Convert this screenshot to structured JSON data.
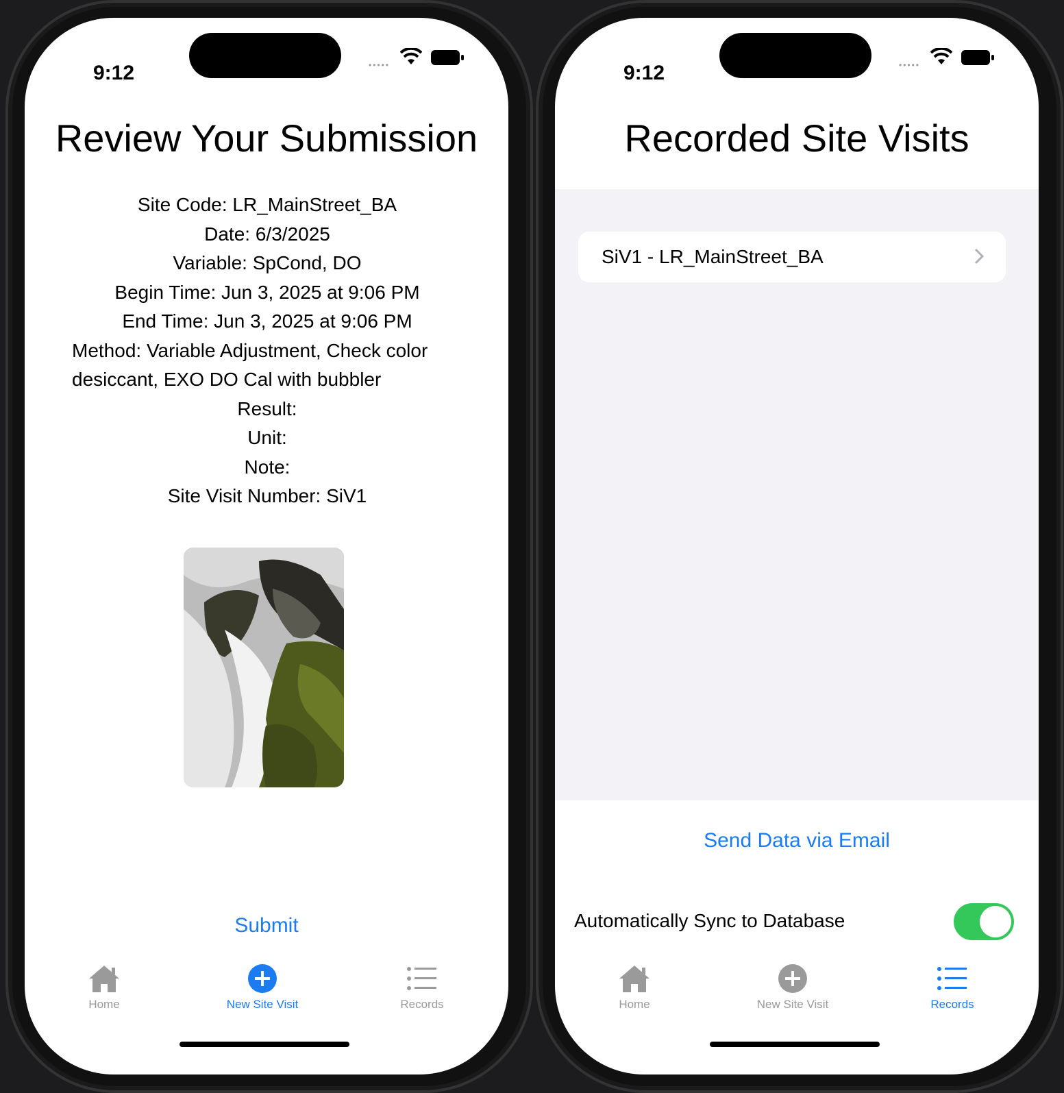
{
  "left": {
    "status_time": "9:12",
    "title": "Review Your Submission",
    "details": {
      "site_code": "Site Code: LR_MainStreet_BA",
      "date": "Date: 6/3/2025",
      "variable": "Variable: SpCond, DO",
      "begin_time": "Begin Time: Jun 3, 2025 at 9:06 PM",
      "end_time": "End Time: Jun 3, 2025 at 9:06 PM",
      "method": "Method: Variable Adjustment, Check color desiccant, EXO DO Cal with bubbler",
      "result": "Result:",
      "unit": "Unit:",
      "note": "Note:",
      "site_visit_number": "Site Visit Number: SiV1"
    },
    "submit_label": "Submit",
    "tabs": [
      {
        "label": "Home",
        "icon": "house-icon",
        "active": false
      },
      {
        "label": "New Site Visit",
        "icon": "plus-circle-icon",
        "active": true
      },
      {
        "label": "Records",
        "icon": "list-icon",
        "active": false
      }
    ]
  },
  "right": {
    "status_time": "9:12",
    "title": "Recorded Site Visits",
    "records": [
      {
        "label": "SiV1 - LR_MainStreet_BA"
      }
    ],
    "send_email_label": "Send Data via Email",
    "sync_label": "Automatically Sync to Database",
    "sync_enabled": true,
    "tabs": [
      {
        "label": "Home",
        "icon": "house-icon",
        "active": false
      },
      {
        "label": "New Site Visit",
        "icon": "plus-circle-icon",
        "active": false
      },
      {
        "label": "Records",
        "icon": "list-icon",
        "active": true
      }
    ]
  },
  "colors": {
    "accent": "#1a7cf0",
    "inactive_tab": "#9a9a9a",
    "toggle_on": "#34c759",
    "list_background": "#f2f2f7"
  }
}
